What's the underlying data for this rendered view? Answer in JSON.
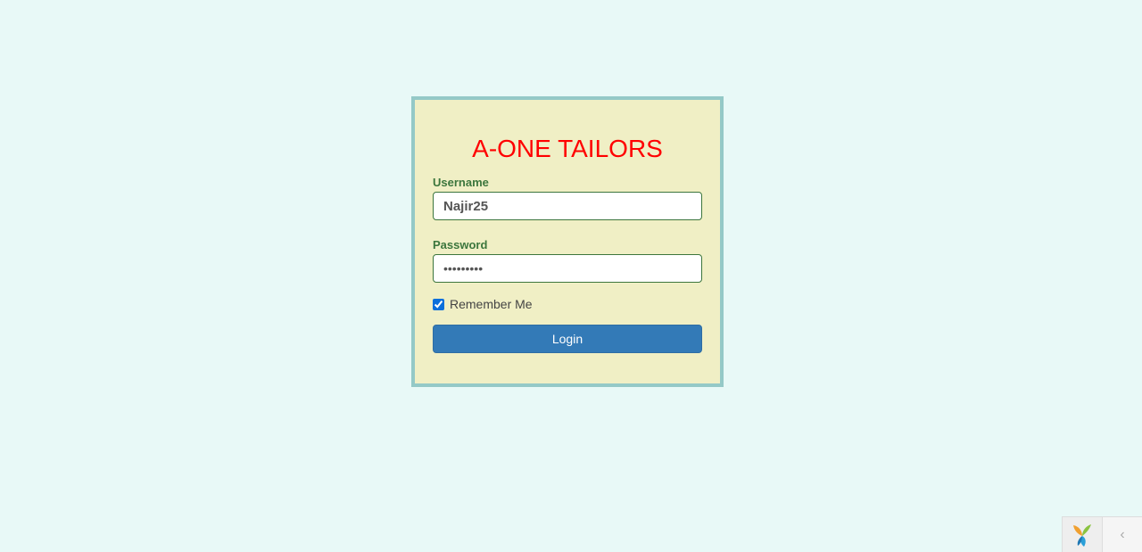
{
  "brand": {
    "title": "A-ONE TAILORS",
    "title_color": "#ff0000"
  },
  "form": {
    "username_label": "Username",
    "username_value": "Najir25",
    "password_label": "Password",
    "password_value": "•••••••••",
    "remember_label": "Remember Me",
    "remember_checked": true,
    "login_label": "Login"
  },
  "toolbar": {
    "logo_icon": "yii-logo-icon",
    "toggle_icon": "chevron-left-icon",
    "toggle_glyph": "‹"
  },
  "colors": {
    "page_bg": "#e8f9f7",
    "box_bg": "#f0efc5",
    "box_border": "#94c9c7",
    "label_color": "#3c763d",
    "button_bg": "#337ab7"
  }
}
